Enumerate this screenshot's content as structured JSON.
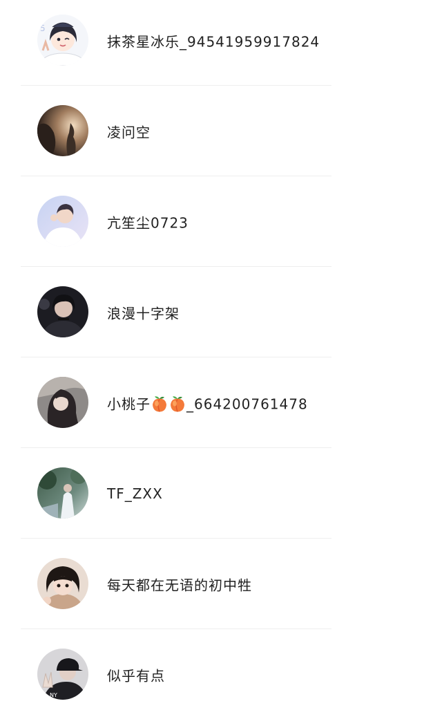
{
  "users": [
    {
      "name": "抹茶星冰乐_94541959917824",
      "avatar_icon": "avatar-cartoon-girl"
    },
    {
      "name": "凌问空",
      "avatar_icon": "avatar-dark-photo"
    },
    {
      "name": "亢笙尘0723",
      "avatar_icon": "avatar-white-outfit"
    },
    {
      "name": "浪漫十字架",
      "avatar_icon": "avatar-dark-portrait"
    },
    {
      "name_prefix": "小桃子",
      "name_suffix": "_664200761478",
      "name_emojis": [
        "peach-emoji",
        "peach-emoji"
      ],
      "avatar_icon": "avatar-long-hair"
    },
    {
      "name": "TF_ZXX",
      "avatar_icon": "avatar-green-scene"
    },
    {
      "name": "每天都在无语的初中牲",
      "avatar_icon": "avatar-child-photo"
    },
    {
      "name": "似乎有点",
      "avatar_icon": "avatar-cap-peace-sign"
    }
  ],
  "colors": {
    "text": "#222222",
    "divider": "#eeeeee",
    "background": "#ffffff"
  }
}
